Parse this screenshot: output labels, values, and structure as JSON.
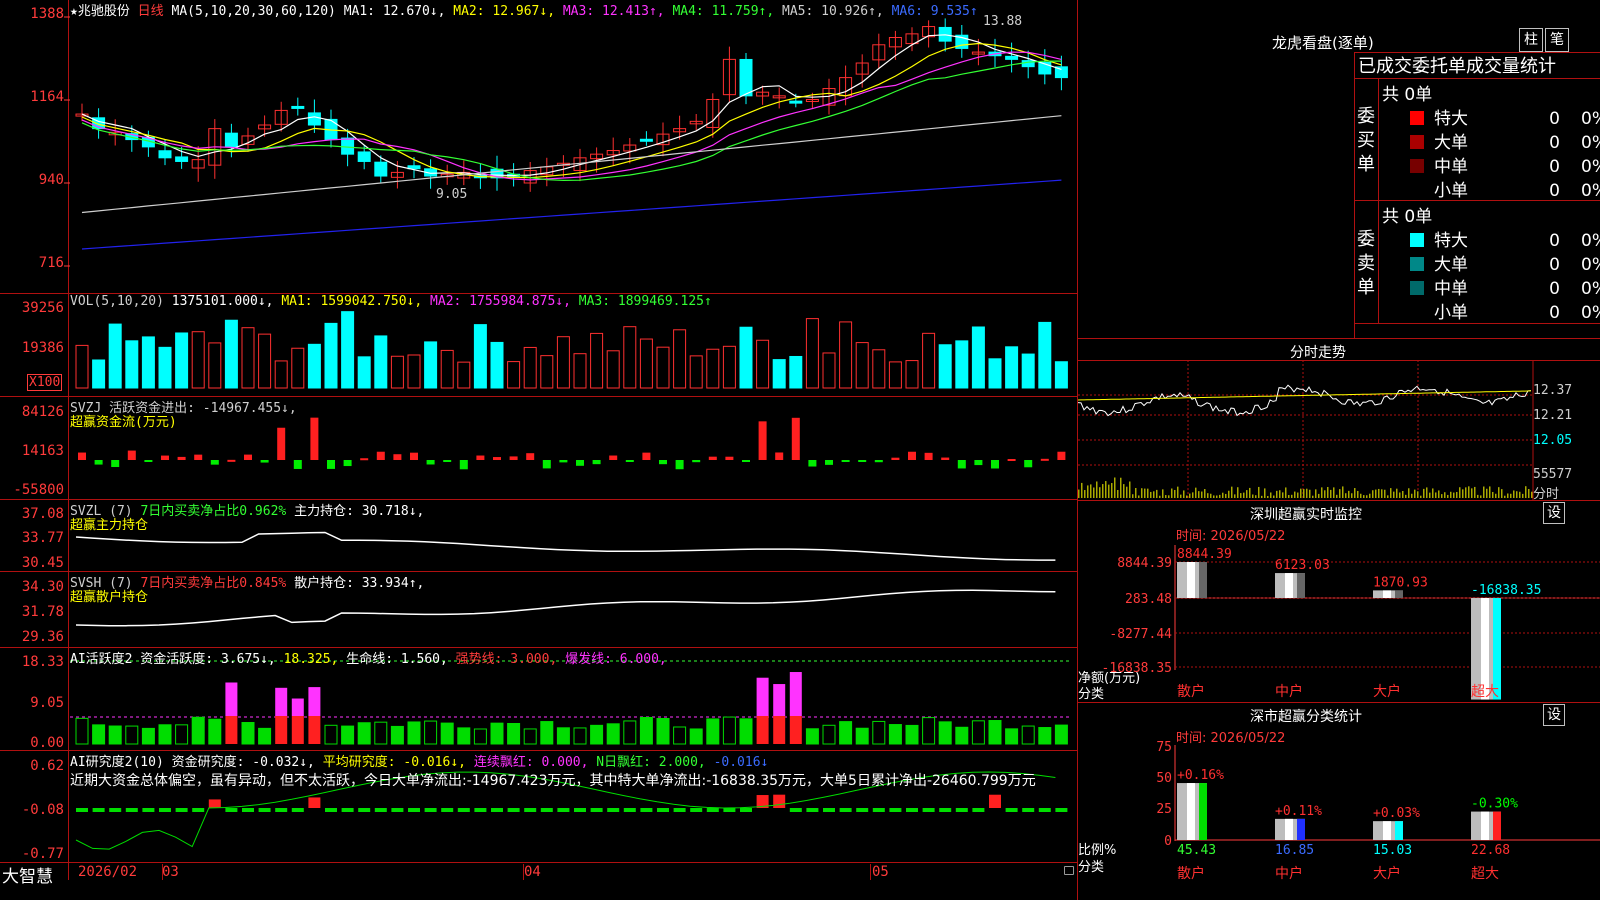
{
  "stock": {
    "name": "★兆驰股份",
    "period": "日线",
    "ma_label": "MA(5,10,20,30,60,120)",
    "ma1": "MA1: 12.670↓,",
    "ma2": "MA2: 12.967↓,",
    "ma3": "MA3: 12.413↑,",
    "ma4": "MA4: 11.759↑,",
    "ma5": "MA5: 10.926↑,",
    "ma6": "MA6: 9.535↑"
  },
  "price_axis": [
    "1388",
    "1164",
    "940",
    "716"
  ],
  "price_marks": {
    "high": "13.88",
    "low": "9.05"
  },
  "vol": {
    "label": "VOL(5,10,20)",
    "value": "1375101.000↓,",
    "ma1": "MA1: 1599042.750↓,",
    "ma2": "MA2: 1755984.875↓,",
    "ma3": "MA3: 1899469.125↑",
    "axis": [
      "39256",
      "19386"
    ],
    "unit": "X100"
  },
  "svzj": {
    "label": "SVZJ  活跃资金进出: -14967.455↓,",
    "sub": "超赢资金流(万元)",
    "axis": [
      "84126",
      "14163",
      "-55800"
    ]
  },
  "svzl": {
    "label": "SVZL (7)",
    "l1": "7日内买卖净占比0.962%",
    "l2": "主力持仓: 30.718↓,",
    "sub": "超赢主力持仓",
    "axis": [
      "37.08",
      "33.77",
      "30.45"
    ]
  },
  "svsh": {
    "label": "SVSH (7)",
    "l1": "7日内买卖净占比0.845%",
    "l2": "散户持仓: 33.934↑,",
    "sub": "超赢散户持仓",
    "axis": [
      "34.30",
      "31.78",
      "29.36"
    ]
  },
  "ai1": {
    "label": "AI活跃度2 资金活跃度: 3.675↓,",
    "v2": "18.325,",
    "v3": "生命线: 1.560,",
    "v4": "强势线: 3.000,",
    "v5": "爆发线: 6.000,",
    "axis": [
      "18.33",
      "9.05",
      "0.00"
    ]
  },
  "ai2": {
    "label": "AI研究度2(10) 资金研究度: -0.032↓,",
    "v2": "平均研究度: -0.016↓,",
    "v3": "连续飘红: 0.000,",
    "v4": "N日飘红: 2.000,",
    "v5": "-0.016↓",
    "text": "近期大资金总体偏空，虽有异动，但不太活跃，今日大单净流出:-14967.423万元，其中特大单净流出:-16838.35万元，大单5日累计净出-26460.799万元",
    "axis": [
      "0.62",
      "-0.08",
      "-0.77"
    ]
  },
  "timeline": {
    "brand": "大智慧",
    "labels": [
      "2026/02",
      "03",
      "04",
      "05"
    ]
  },
  "dragon": {
    "title": "龙虎看盘(逐单)",
    "btn1": "柱",
    "btn2": "笔",
    "header": "已成交委托单成交量统计",
    "buy": {
      "side": "委买单",
      "total": "共 0单",
      "rows": [
        {
          "name": "特大",
          "n": "0",
          "p": "0%",
          "color": "#ff0000"
        },
        {
          "name": "大单",
          "n": "0",
          "p": "0%",
          "color": "#aa0000"
        },
        {
          "name": "中单",
          "n": "0",
          "p": "0%",
          "color": "#770000"
        },
        {
          "name": "小单",
          "n": "0",
          "p": "0%",
          "color": ""
        }
      ]
    },
    "sell": {
      "side": "委卖单",
      "total": "共 0单",
      "rows": [
        {
          "name": "特大",
          "n": "0",
          "p": "0%",
          "color": "#00ffff"
        },
        {
          "name": "大单",
          "n": "0",
          "p": "0%",
          "color": "#008888"
        },
        {
          "name": "中单",
          "n": "0",
          "p": "0%",
          "color": "#006a6a"
        },
        {
          "name": "小单",
          "n": "0",
          "p": "0%",
          "color": ""
        }
      ]
    }
  },
  "intraday": {
    "title": "分时走势",
    "axis": [
      "12.37",
      "12.21",
      "12.05"
    ],
    "vol": "55577",
    "tag": "分时"
  },
  "monitor": {
    "title": "深圳超赢实时监控",
    "set": "设",
    "time": "时间: 2026/05/22",
    "axis": [
      "8844.39",
      "283.48",
      "-8277.44",
      "-16838.35"
    ],
    "ylabel": "净额(万元)",
    "xlabel": "分类",
    "categories": [
      "散户",
      "中户",
      "大户",
      "超大"
    ],
    "values": [
      8844.39,
      6123.03,
      1870.93,
      -16838.35
    ],
    "value_labels": [
      "8844.39",
      "6123.03",
      "1870.93",
      "-16838.35"
    ]
  },
  "classify": {
    "title": "深市超赢分类统计",
    "set": "设",
    "time": "时间: 2026/05/22",
    "axis": [
      "75",
      "50",
      "25",
      "0"
    ],
    "ylabel": "比例%",
    "xlabel": "分类",
    "categories": [
      "散户",
      "中户",
      "大户",
      "超大"
    ],
    "values": [
      45.43,
      16.85,
      15.03,
      22.68
    ],
    "changes": [
      "+0.16%",
      "+0.11%",
      "+0.03%",
      "-0.30%"
    ],
    "value_labels": [
      "45.43",
      "16.85",
      "15.03",
      "22.68"
    ]
  }
}
